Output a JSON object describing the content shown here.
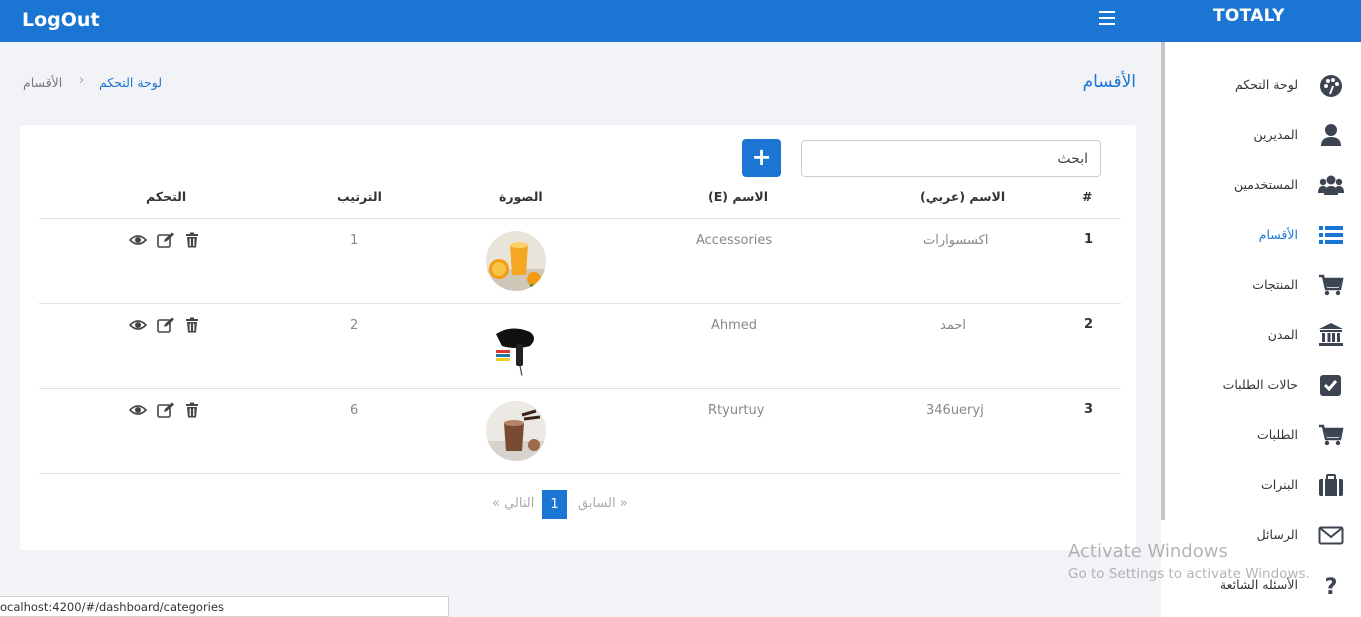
{
  "topbar": {
    "logout_label": "LogOut",
    "brand": "TOTALY"
  },
  "sidebar": {
    "items": [
      {
        "label": "لوحة التحكم",
        "icon": "palette-icon"
      },
      {
        "label": "المديرين",
        "icon": "user-icon"
      },
      {
        "label": "المستخدمين",
        "icon": "users-icon"
      },
      {
        "label": "الأقسام",
        "icon": "list-icon",
        "active": true
      },
      {
        "label": "المنتجات",
        "icon": "cart-icon"
      },
      {
        "label": "المدن",
        "icon": "bank-icon"
      },
      {
        "label": "حالات الطلبات",
        "icon": "check-square-icon"
      },
      {
        "label": "الطلبات",
        "icon": "cart-icon"
      },
      {
        "label": "البنرات",
        "icon": "briefcase-icon"
      },
      {
        "label": "الرسائل",
        "icon": "envelope-icon"
      },
      {
        "label": "الأسئله الشائعة",
        "icon": "question-icon"
      }
    ]
  },
  "page": {
    "title": "الأقسام",
    "breadcrumb": {
      "link": "لوحة التحكم",
      "separator": "›",
      "current": "الأقسام"
    }
  },
  "toolbar": {
    "search_placeholder": "ابحث",
    "add_label": "+"
  },
  "table": {
    "headers": {
      "index": "#",
      "name_ar": "الاسم (عربي)",
      "name_en": "الاسم (E)",
      "image": "الصورة",
      "order": "الترتيب",
      "actions": "التحكم"
    },
    "rows": [
      {
        "index": "1",
        "name_ar": "اكسسوارات",
        "name_en": "Accessories",
        "image": "orange-juice",
        "order": "1"
      },
      {
        "index": "2",
        "name_ar": "احمد",
        "name_en": "Ahmed",
        "image": "hair-dryer",
        "order": "2"
      },
      {
        "index": "3",
        "name_ar": "346ueryj",
        "name_en": "Rtyurtuy",
        "image": "chocolate-drink",
        "order": "6"
      }
    ]
  },
  "pagination": {
    "prev": "« السابق",
    "current": "1",
    "next": "التالي »"
  },
  "watermark": {
    "line1": "Activate Windows",
    "line2": "Go to Settings to activate Windows."
  },
  "statusbar": {
    "url": "ocalhost:4200/#/dashboard/categories"
  },
  "colors": {
    "primary": "#1b76d3",
    "background": "#f2f3f7",
    "icon": "#3d4451"
  }
}
